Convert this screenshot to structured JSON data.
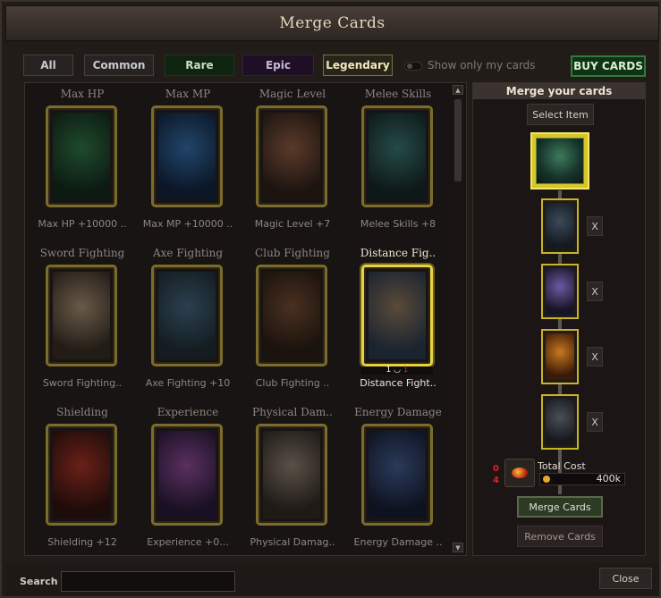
{
  "window": {
    "title": "Merge Cards"
  },
  "filters": {
    "all": "All",
    "common": "Common",
    "rare": "Rare",
    "epic": "Epic",
    "legendary": "Legendary",
    "show_only_mine": "Show only my cards",
    "buy_cards": "BUY CARDS"
  },
  "cards": [
    {
      "title": "Max HP",
      "label": "Max HP +10000 ..",
      "art": [
        "#1f4a2c",
        "#0c1a12"
      ]
    },
    {
      "title": "Max MP",
      "label": "Max MP +10000 ..",
      "art": [
        "#21456a",
        "#0b1626"
      ]
    },
    {
      "title": "Magic Level",
      "label": "Magic Level +7",
      "art": [
        "#5a3a2a",
        "#1d1410"
      ]
    },
    {
      "title": "Melee Skills",
      "label": "Melee Skills +8",
      "art": [
        "#254a48",
        "#0d1918"
      ]
    },
    {
      "title": "Sword Fighting",
      "label": "Sword Fighting..",
      "art": [
        "#6a5a48",
        "#221c16"
      ]
    },
    {
      "title": "Axe Fighting",
      "label": "Axe Fighting +10",
      "art": [
        "#2a4050",
        "#141c20"
      ]
    },
    {
      "title": "Club Fighting",
      "label": "Club Fighting ..",
      "art": [
        "#4a3020",
        "#1a120d"
      ]
    },
    {
      "title": "Distance Fig..",
      "label": "Distance Fight..",
      "art": [
        "#5a4a3a",
        "#1a2430"
      ],
      "selected": true,
      "qty_a": "1",
      "qty_b": "1"
    },
    {
      "title": "Shielding",
      "label": "Shielding +12",
      "art": [
        "#6a2018",
        "#1e0c0a"
      ]
    },
    {
      "title": "Experience",
      "label": "Experience +0...",
      "art": [
        "#5a3060",
        "#1a1024"
      ]
    },
    {
      "title": "Physical Dam..",
      "label": "Physical Damag..",
      "art": [
        "#5a5048",
        "#1e1a16"
      ]
    },
    {
      "title": "Energy Damage",
      "label": "Energy Damage ..",
      "art": [
        "#2a3a5a",
        "#0e1220"
      ]
    }
  ],
  "merge": {
    "heading": "Merge your cards",
    "select_item": "Select Item",
    "slots": [
      {
        "remove": "X",
        "art": [
          "#3a4a5a",
          "#141a20"
        ]
      },
      {
        "remove": "X",
        "art": [
          "#6a5aa0",
          "#181428"
        ]
      },
      {
        "remove": "X",
        "art": [
          "#c87820",
          "#3a1a08"
        ]
      },
      {
        "remove": "X",
        "art": [
          "#4a5058",
          "#16181c"
        ]
      }
    ],
    "cost_count_top": "0",
    "cost_count_bottom": "4",
    "total_cost_label": "Total Cost",
    "total_cost_value": "400k",
    "merge_button": "Merge Cards",
    "remove_button": "Remove Cards"
  },
  "footer": {
    "search_label": "Search",
    "search_value": "",
    "close": "Close"
  },
  "icons": {
    "toggle": "toggle-switch-icon",
    "coin": "gold-coin-icon",
    "cost_item": "fire-orb-icon",
    "scroll_up": "chevron-up-icon",
    "scroll_down": "chevron-down-icon"
  }
}
